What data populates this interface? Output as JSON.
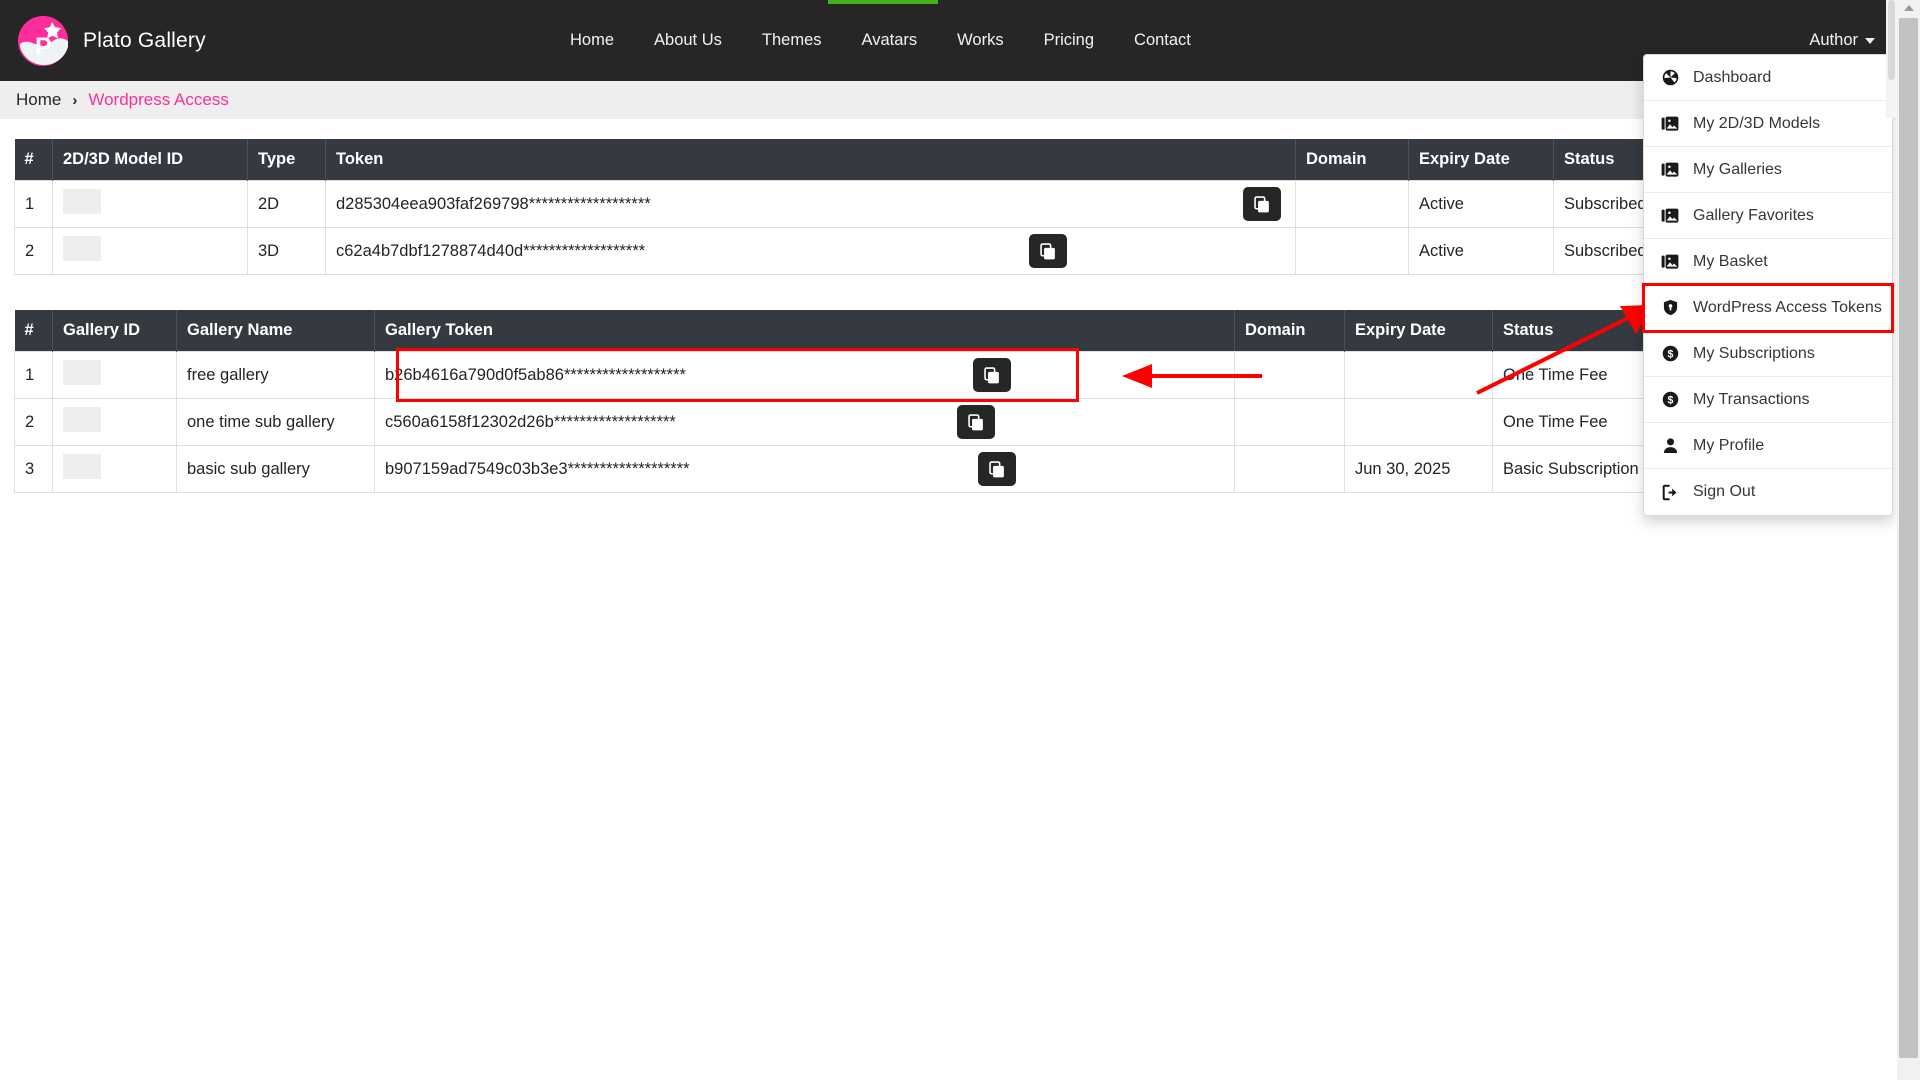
{
  "brand": {
    "name": "Plato Gallery",
    "logo_icon": "plato-logo-icon"
  },
  "navbar": {
    "links": [
      {
        "label": "Home"
      },
      {
        "label": "About Us"
      },
      {
        "label": "Themes"
      },
      {
        "label": "Avatars"
      },
      {
        "label": "Works"
      },
      {
        "label": "Pricing"
      },
      {
        "label": "Contact"
      }
    ],
    "account_label": "Author",
    "caret_icon": "chevron-down-icon"
  },
  "breadcrumb": {
    "home": "Home",
    "separator": "›",
    "current": "Wordpress Access"
  },
  "dropdown": {
    "items": [
      {
        "label": "Dashboard",
        "icon": "dashboard-icon",
        "highlighted": false
      },
      {
        "label": "My 2D/3D Models",
        "icon": "image-stack-icon",
        "highlighted": false
      },
      {
        "label": "My Galleries",
        "icon": "image-stack-icon",
        "highlighted": false
      },
      {
        "label": "Gallery Favorites",
        "icon": "image-stack-icon",
        "highlighted": false
      },
      {
        "label": "My Basket",
        "icon": "image-stack-icon",
        "highlighted": false
      },
      {
        "label": "WordPress Access Tokens",
        "icon": "shield-icon",
        "highlighted": true
      },
      {
        "label": "My Subscriptions",
        "icon": "dollar-circle-icon",
        "highlighted": false
      },
      {
        "label": "My Transactions",
        "icon": "dollar-circle-icon",
        "highlighted": false
      },
      {
        "label": "My Profile",
        "icon": "user-icon",
        "highlighted": false
      },
      {
        "label": "Sign Out",
        "icon": "sign-out-icon",
        "highlighted": false
      }
    ]
  },
  "models_table": {
    "headers": [
      "#",
      "2D/3D Model ID",
      "Type",
      "Token",
      "",
      "Domain",
      "Expiry Date",
      "Status"
    ],
    "rows": [
      {
        "num": "1",
        "model_id": "",
        "type": "2D",
        "token": "d285304eea903faf269798*******************",
        "copy_icon": "copy-icon",
        "domain": "",
        "expiry": "Active",
        "status": "Subscribed"
      },
      {
        "num": "2",
        "model_id": "",
        "type": "3D",
        "token": "c62a4b7dbf1278874d40d*******************",
        "copy_icon": "copy-icon",
        "domain": "",
        "expiry": "Active",
        "status": "Subscribed"
      }
    ]
  },
  "gallery_table": {
    "headers": [
      "#",
      "Gallery ID",
      "Gallery Name",
      "Gallery Token",
      "",
      "Domain",
      "Expiry Date",
      "Status"
    ],
    "rows": [
      {
        "num": "1",
        "gallery_id": "",
        "gallery_name": "free gallery",
        "token": "b26b4616a790d0f5ab86*******************",
        "copy_icon": "copy-icon",
        "domain": "",
        "expiry": "",
        "status": "One Time Fee"
      },
      {
        "num": "2",
        "gallery_id": "",
        "gallery_name": "one time sub gallery",
        "token": "c560a6158f12302d26b*******************",
        "copy_icon": "copy-icon",
        "domain": "",
        "expiry": "",
        "status": "One Time Fee"
      },
      {
        "num": "3",
        "gallery_id": "",
        "gallery_name": "basic sub gallery",
        "token": "b907159ad7549c03b3e3*******************",
        "copy_icon": "copy-icon",
        "domain": "",
        "expiry": "Jun 30, 2025",
        "status": "Basic Subscription"
      }
    ]
  },
  "colors": {
    "brand_pink": "#ff2d9b",
    "nav_dark": "#262626",
    "table_header": "#343a40",
    "annotation_red": "#ff0000",
    "loading_green": "#3fb318"
  }
}
